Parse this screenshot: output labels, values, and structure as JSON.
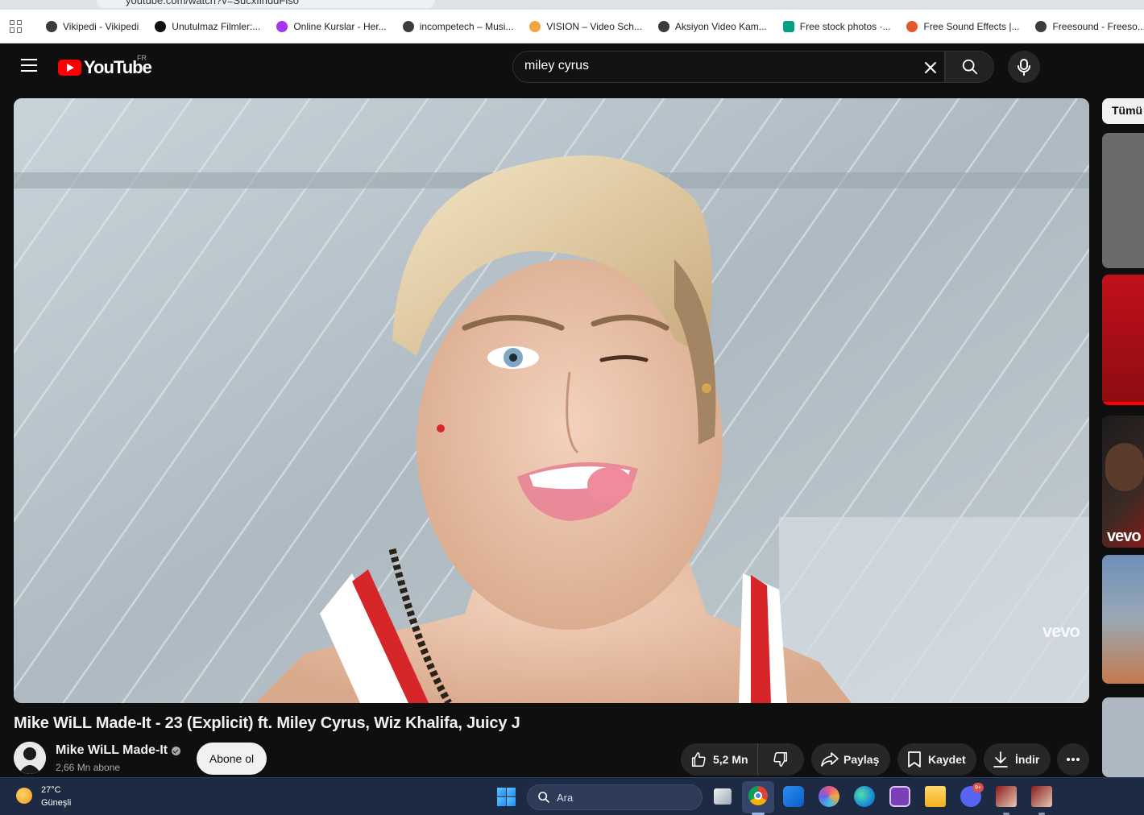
{
  "browser": {
    "url": "youtube.com/watch?v=SucxfihudFiso",
    "bookmarks": [
      {
        "label": "Vikipedi - Vikipedi",
        "color": "#3c3c3c"
      },
      {
        "label": "Unutulmaz Filmler:...",
        "color": "#111111"
      },
      {
        "label": "Online Kurslar - Her...",
        "color": "#a435f0"
      },
      {
        "label": "incompetech – Musi...",
        "color": "#3c3c3c"
      },
      {
        "label": "VISION – Video Sch...",
        "color": "#f2a640"
      },
      {
        "label": "Aksiyon Video Kam...",
        "color": "#3c3c3c"
      },
      {
        "label": "Free stock photos ·...",
        "color": "#05a081"
      },
      {
        "label": "Free Sound Effects |...",
        "color": "#e2572b"
      },
      {
        "label": "Freesound - Freeso...",
        "color": "#3c3c3c"
      }
    ]
  },
  "header": {
    "logo_text": "YouTube",
    "country_code": "FR",
    "search_value": "miley cyrus"
  },
  "player": {
    "watermark": "vevo"
  },
  "sidebar": {
    "chip_label": "Tümü",
    "thumb_watermark": "vevo"
  },
  "video": {
    "title": "Mike WiLL Made-It - 23 (Explicit) ft. Miley Cyrus, Wiz Khalifa, Juicy J",
    "channel": "Mike WiLL Made-It",
    "subscribers": "2,66 Mn abone",
    "subscribe_label": "Abone ol",
    "likes": "5,2 Mn",
    "share_label": "Paylaş",
    "save_label": "Kaydet",
    "download_label": "İndir"
  },
  "taskbar": {
    "temperature": "27°C",
    "condition": "Güneşli",
    "search_placeholder": "Ara",
    "notification_count": "9+"
  },
  "colors": {
    "background": "#0f0f0f",
    "accent_red": "#ff0000",
    "pill_bg": "#272727",
    "taskbar_bg": "#1c2a44"
  }
}
